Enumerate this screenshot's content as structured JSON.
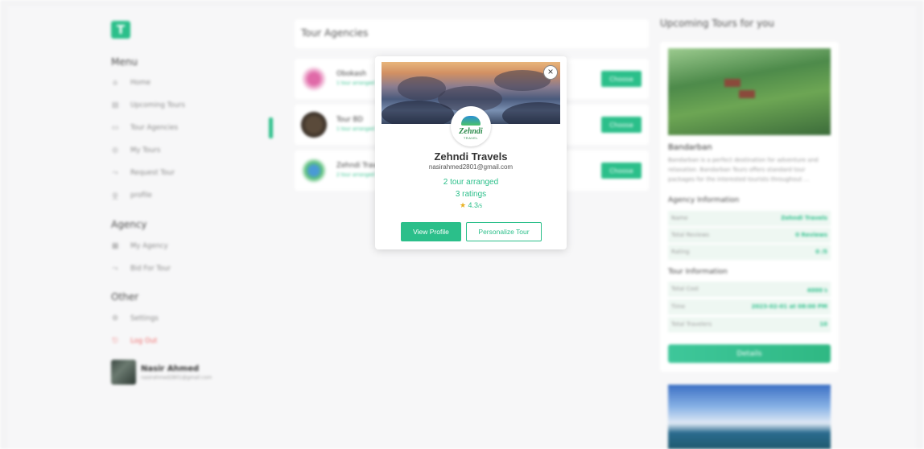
{
  "app": {
    "logo_letter": "T",
    "accent_color": "#2bbf8a"
  },
  "sidebar": {
    "menu_title": "Menu",
    "menu_items": [
      {
        "label": "Home",
        "icon": "home-icon"
      },
      {
        "label": "Upcoming Tours",
        "icon": "calendar-icon"
      },
      {
        "label": "Tour Agencies",
        "icon": "list-icon"
      },
      {
        "label": "My Tours",
        "icon": "compass-icon"
      },
      {
        "label": "Request Tour",
        "icon": "route-icon"
      },
      {
        "label": "profile",
        "icon": "user-icon"
      }
    ],
    "agency_title": "Agency",
    "agency_items": [
      {
        "label": "My Agency",
        "icon": "building-icon"
      },
      {
        "label": "Bid For Tour",
        "icon": "route-icon"
      }
    ],
    "other_title": "Other",
    "other_items": [
      {
        "label": "Settings",
        "icon": "gear-icon"
      },
      {
        "label": "Log Out",
        "icon": "logout-icon"
      }
    ],
    "user": {
      "name": "Nasir Ahmed",
      "email": "nasirahmed2801@gmail.com"
    }
  },
  "agencies": {
    "title": "Tour Agencies",
    "choose_label": "Choose",
    "rows": [
      {
        "name": "Obokash",
        "sub": "1 tour arranged"
      },
      {
        "name": "Tour BD",
        "sub": "1 tour arranged"
      },
      {
        "name": "Zehndi Travels",
        "sub": "2 tour arranged"
      }
    ]
  },
  "upcoming": {
    "title": "Upcoming Tours for you",
    "tour": {
      "name": "Bandarban",
      "description": "Bandarban is a perfect destination for adventure and relaxation. Bandarban Tours offers standard tour packages for the interested tourists throughout ...",
      "agency_section": "Agency Information",
      "agency_info": [
        {
          "key": "Name",
          "value": "Zehndi Travels"
        },
        {
          "key": "Total Reviews",
          "value": "0 Reviews"
        },
        {
          "key": "Rating",
          "value": "0 /5"
        }
      ],
      "tour_section": "Tour Information",
      "tour_info": [
        {
          "key": "Total Cost",
          "value": "4000 ৳"
        },
        {
          "key": "Time",
          "value": "2023-02-01 at 08:00 PM"
        },
        {
          "key": "Total Travelers",
          "value": "10"
        }
      ],
      "details_label": "Details"
    }
  },
  "modal": {
    "close_symbol": "×",
    "logo_text": "Zehndi",
    "logo_subtext": "TRAVEL",
    "agency_name": "Zehndi Travels",
    "email": "nasirahmed2801@gmail.com",
    "tours_arranged": "2 tour arranged",
    "ratings_count": "3 ratings",
    "rating_star": "★",
    "rating_value": "4.3",
    "rating_scale": "/5",
    "view_profile_label": "View Profile",
    "personalize_label": "Personalize Tour"
  }
}
